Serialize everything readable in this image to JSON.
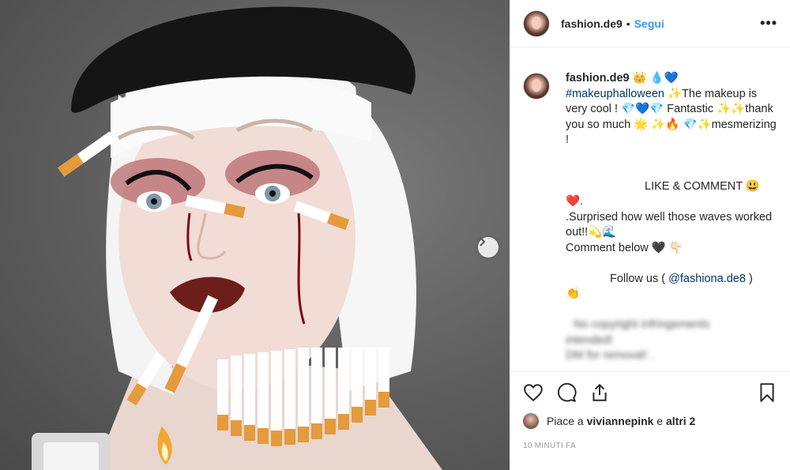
{
  "post": {
    "username": "fashion.de9",
    "follow_label": "Segui",
    "separator": "•",
    "more_label": "•••"
  },
  "caption": {
    "username": "fashion.de9",
    "user_emoji": "👑 💧💙",
    "hashtag": "#makeuphalloween",
    "line1_rest": "✨The makeup is very cool ! 💎💙💎 Fantastic ✨✨thank you so much 🌟 ✨🔥 💎✨mesmerizing !",
    "like_comment": "LIKE & COMMENT 😃",
    "heart_line": "❤️.",
    "waves_line": ".Surprised how well those waves worked out!!💫🌊",
    "comment_below": "Comment below 🖤 👇🏻",
    "follow_prefix": "Follow us (",
    "follow_mention": "@fashiona.de8",
    "follow_suffix": ")",
    "follow_emoji": "👏",
    "blurred_1": "No copyright infringements",
    "blurred_2": "intended!",
    "blurred_3": "DM for removal! ."
  },
  "likes": {
    "prefix": "Piace a",
    "user": "viviannepink",
    "middle": "e",
    "others": "altri 2"
  },
  "timestamp": "10 MINUTI FA",
  "icons": {
    "like": "heart-icon",
    "comment": "comment-icon",
    "share": "share-icon",
    "save": "bookmark-icon",
    "next": "chevron-right-icon"
  }
}
